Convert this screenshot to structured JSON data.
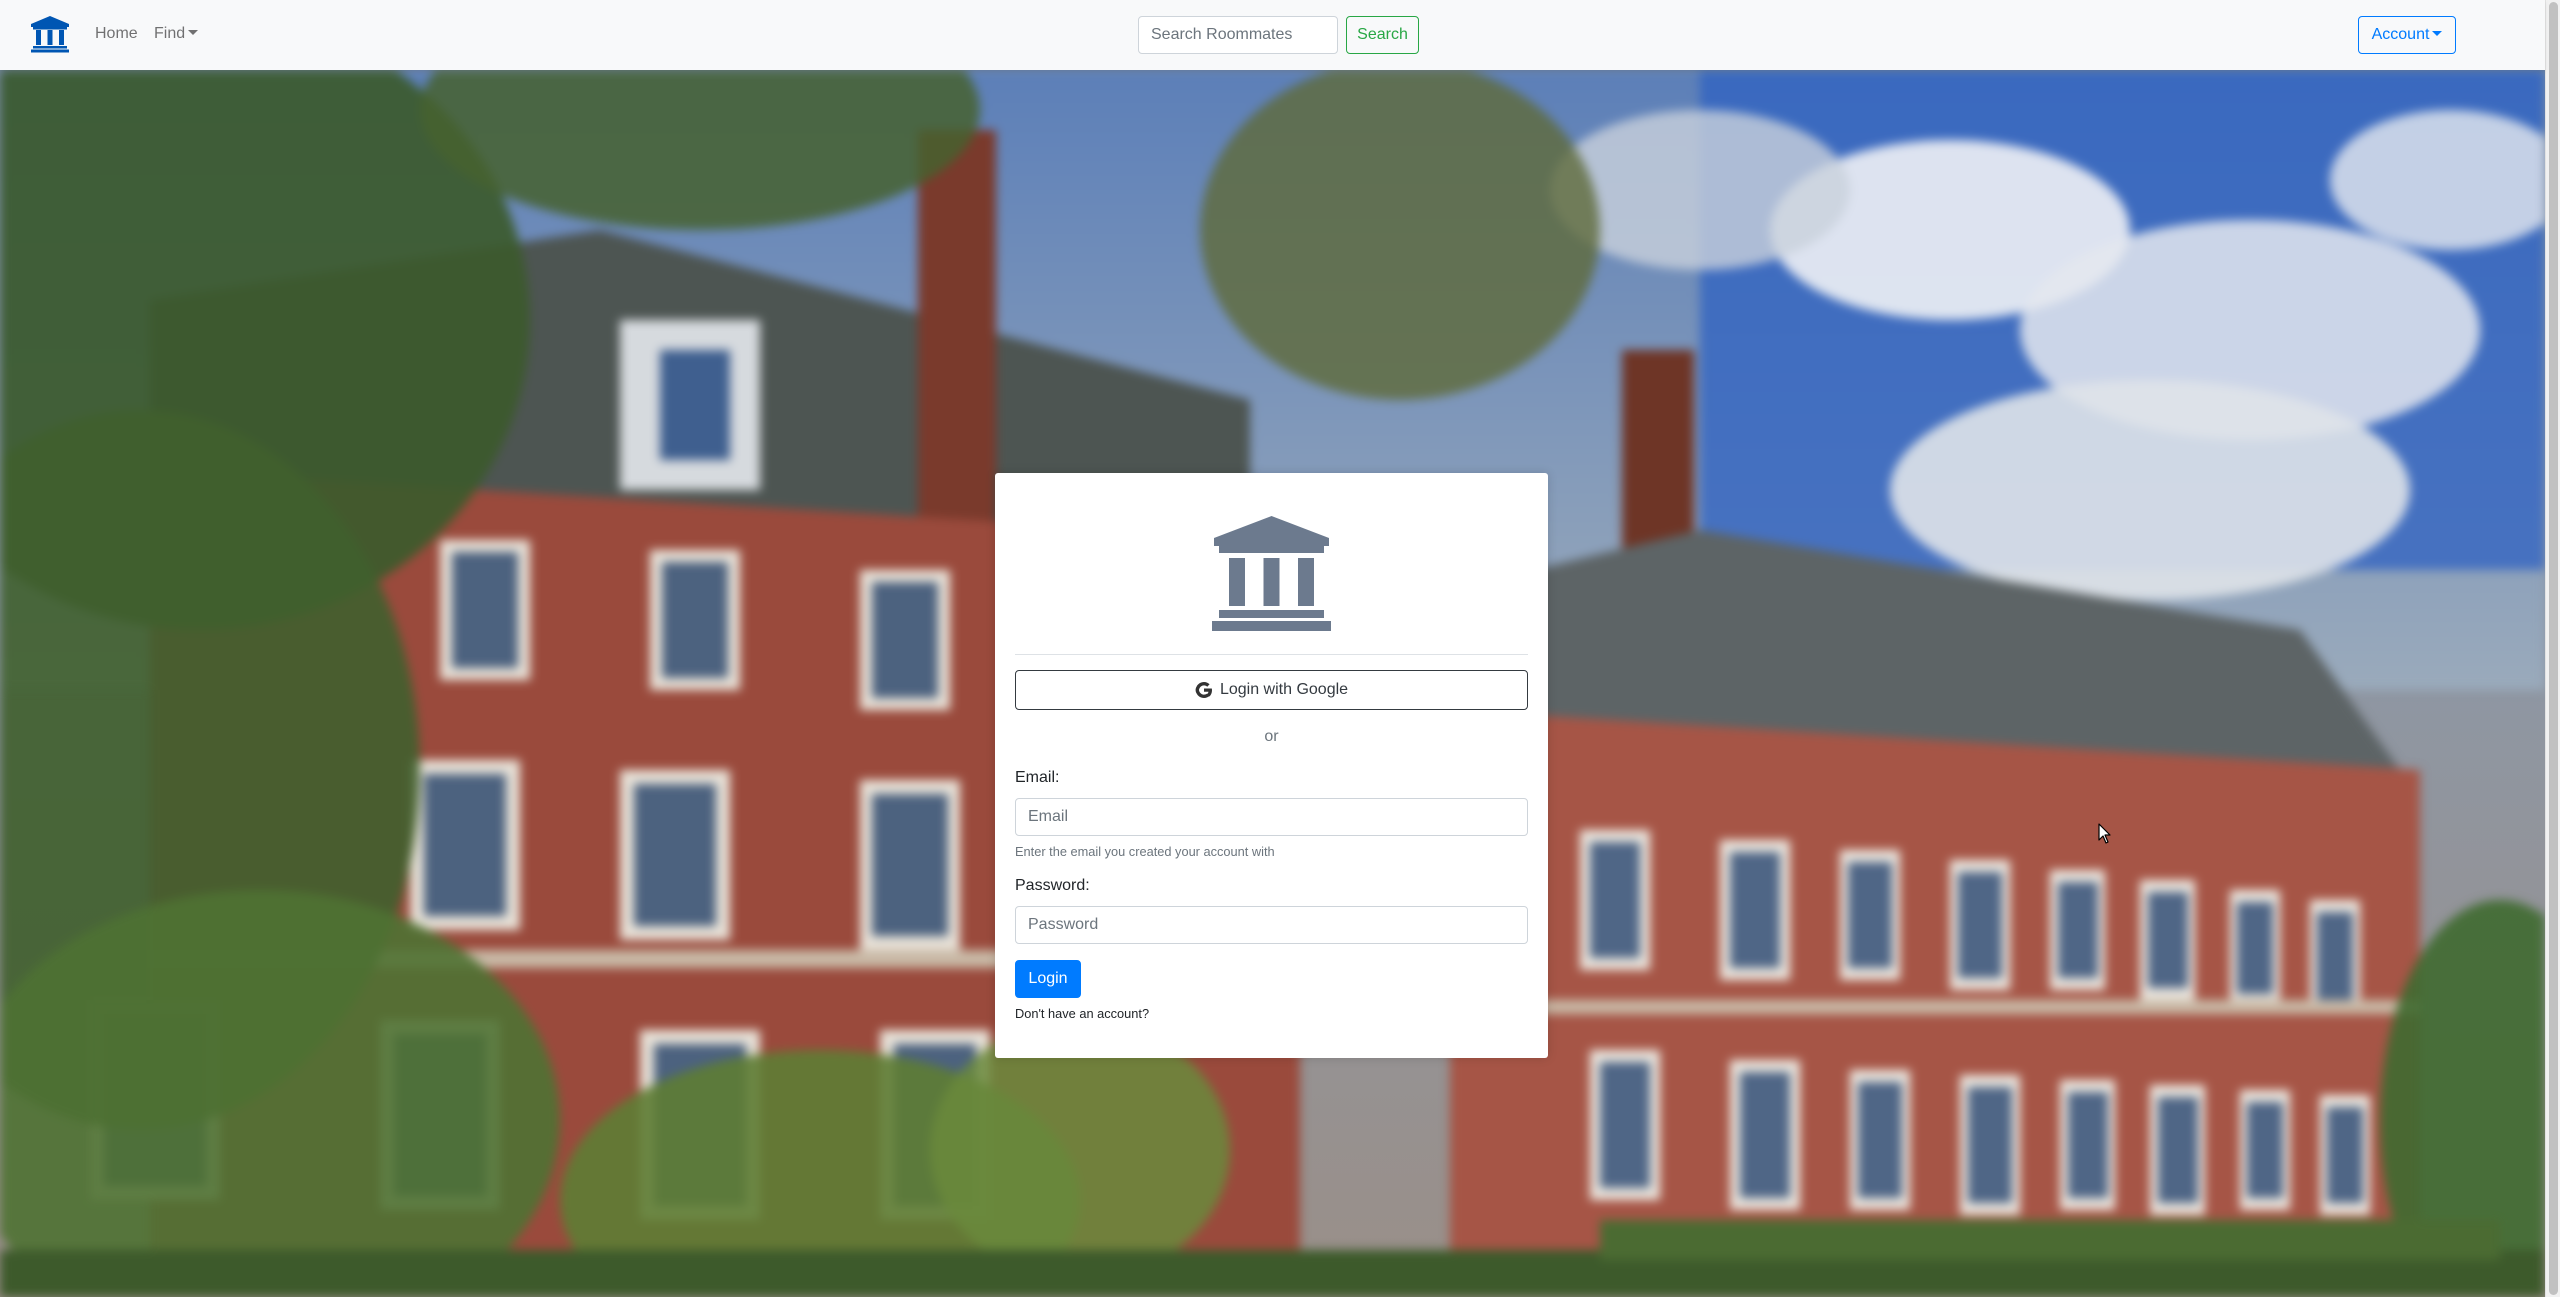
{
  "navbar": {
    "brand_icon": "bank-building-icon",
    "links": [
      {
        "label": "Home"
      },
      {
        "label": "Find",
        "has_dropdown": true
      }
    ],
    "search": {
      "placeholder": "Search Roommates",
      "value": ""
    },
    "search_button": "Search",
    "account_button": "Account",
    "colors": {
      "background": "#f8f9fa",
      "brand": "#0056b3",
      "search_button": "#28a745",
      "account_button": "#007bff"
    }
  },
  "background": {
    "description_icon": "campus-brick-building-photo"
  },
  "login_card": {
    "logo_icon": "bank-building-icon",
    "google_button": "Login with Google",
    "google_icon": "google-g-icon",
    "separator": "or",
    "email": {
      "label": "Email:",
      "placeholder": "Email",
      "value": "",
      "help": "Enter the email you created your account with"
    },
    "password": {
      "label": "Password:",
      "placeholder": "Password",
      "value": ""
    },
    "login_button": "Login",
    "signup_link": "Don't have an account?",
    "colors": {
      "logo": "#6c7a8e",
      "primary": "#007bff",
      "google_border": "#343a40"
    }
  }
}
